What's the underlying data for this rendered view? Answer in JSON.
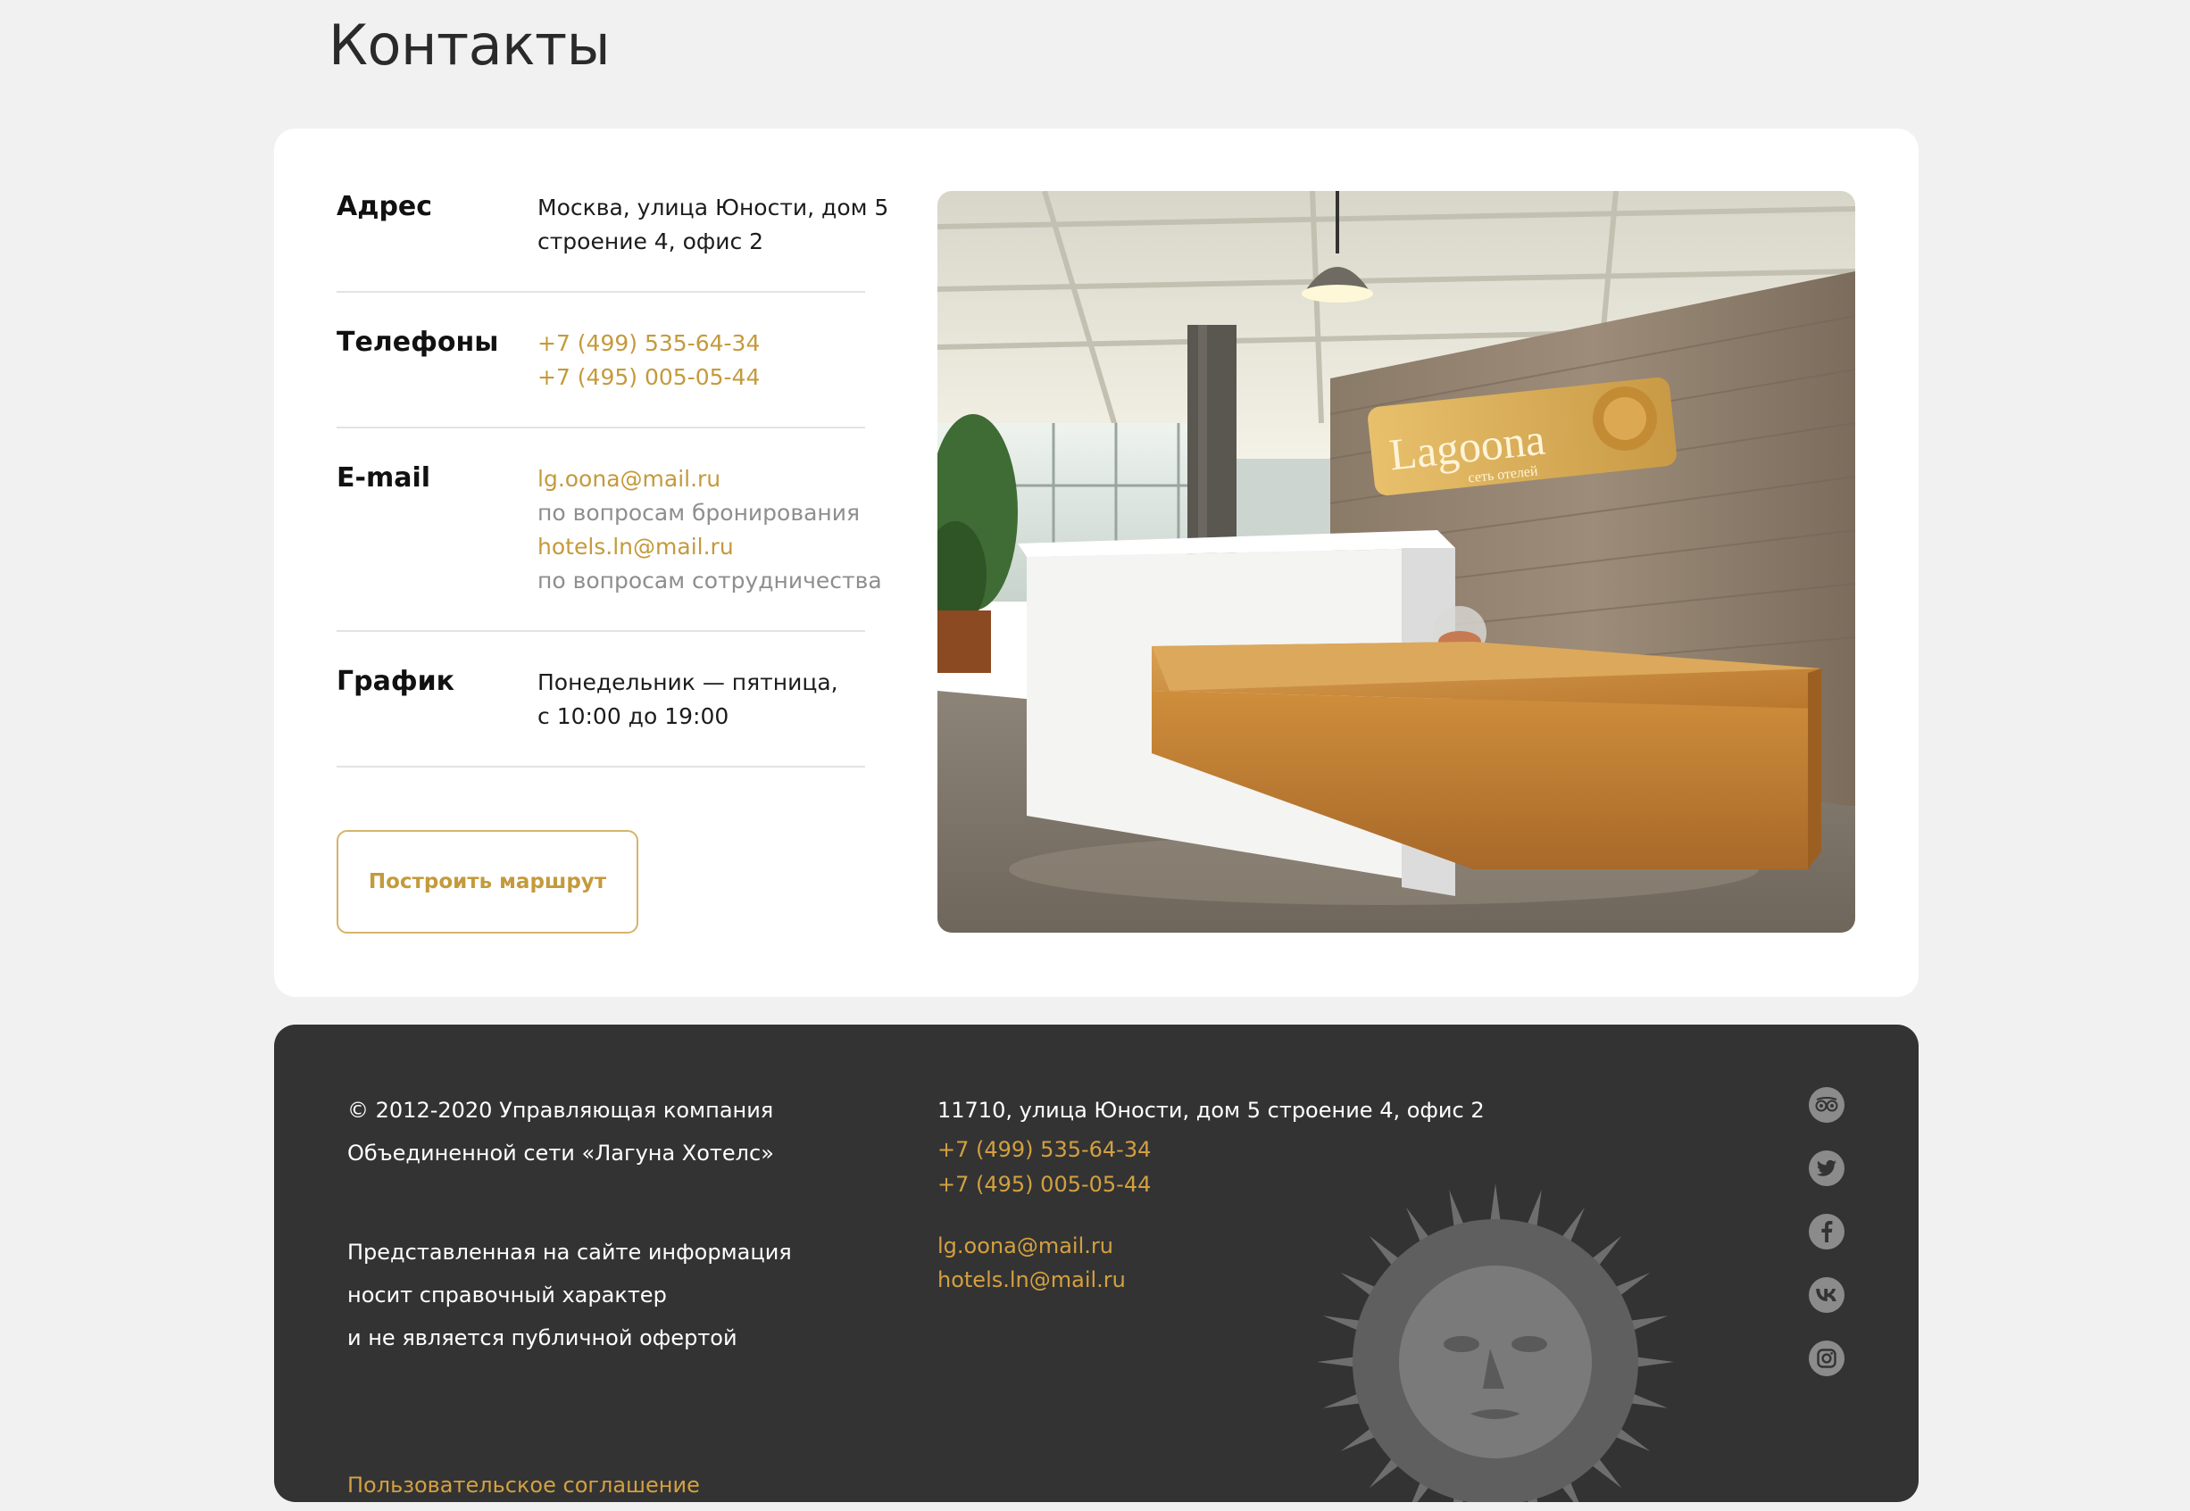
{
  "page": {
    "title": "Контакты"
  },
  "contacts": {
    "address": {
      "label": "Адрес",
      "lines": [
        "Москва, улица Юности, дом 5",
        "строение 4, офис 2"
      ]
    },
    "phones": {
      "label": "Телефоны",
      "items": [
        "+7 (499) 535-64-34",
        "+7 (495) 005-05-44"
      ]
    },
    "email": {
      "label": "E-mail",
      "booking_email": "lg.oona@mail.ru",
      "booking_note": "по вопросам бронирования",
      "partner_email": "hotels.ln@mail.ru",
      "partner_note": "по вопросам сотрудничества"
    },
    "schedule": {
      "label": "График",
      "lines": [
        "Понедельник — пятница,",
        "с 10:00 до 19:00"
      ]
    },
    "route_button": "Построить маршрут",
    "photo": {
      "sign_text": "Lagoona",
      "sign_subtext": "сеть отелей"
    }
  },
  "footer": {
    "copyright": [
      "© 2012-2020 Управляющая компания",
      "Объединенной сети «Лагуна Хотелс»"
    ],
    "disclaimer": [
      "Представленная на сайте информация",
      "носит справочный характер",
      "и не является публичной офертой"
    ],
    "agreement_link": "Пользовательское соглашение",
    "address": "11710, улица Юности, дом 5 строение 4, офис 2",
    "phones": [
      "+7 (499) 535-64-34",
      "+7 (495) 005-05-44"
    ],
    "emails": [
      "lg.oona@mail.ru",
      "hotels.ln@mail.ru"
    ],
    "socials": [
      "tripadvisor-icon",
      "twitter-icon",
      "facebook-icon",
      "vk-icon",
      "instagram-icon"
    ]
  },
  "colors": {
    "accent": "#c49a3b",
    "footer_bg": "#333333",
    "page_bg": "#f1f1f1",
    "icon_gray": "#8b8b8b"
  }
}
